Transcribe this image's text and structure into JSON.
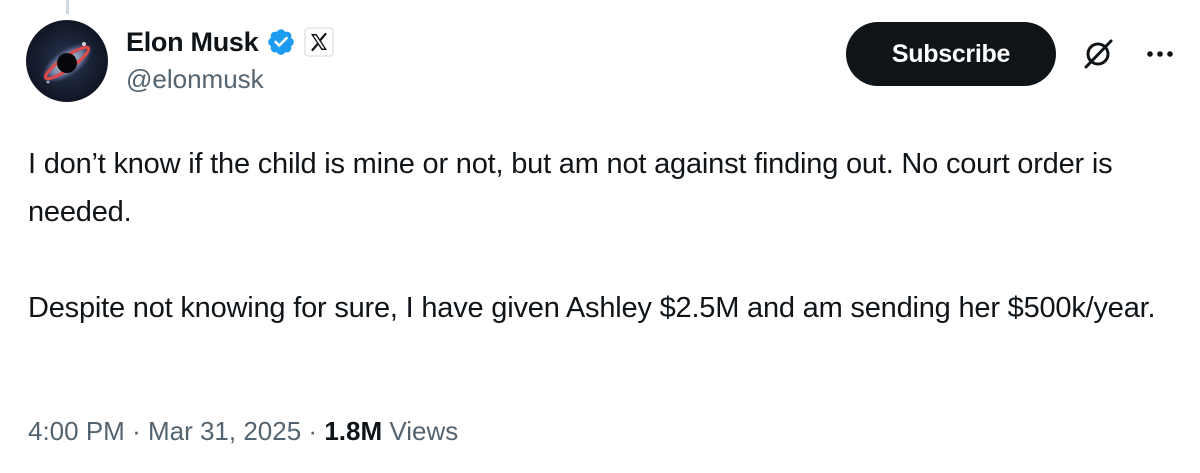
{
  "author": {
    "display_name": "Elon Musk",
    "handle": "@elonmusk",
    "verified_badge": "verified-badge-icon",
    "affiliation_badge": "x-logo-icon"
  },
  "actions": {
    "subscribe_label": "Subscribe",
    "grok_icon": "grok-icon",
    "more_icon": "more-icon"
  },
  "tweet": {
    "paragraphs": [
      "I don’t know if the child is mine or not, but am not against finding out. No court order is needed.",
      "Despite not knowing for sure, I have given Ashley $2.5M and am sending her $500k/year."
    ]
  },
  "meta": {
    "time": "4:00 PM",
    "separator": "·",
    "date": "Mar 31, 2025",
    "views_count": "1.8M",
    "views_label": "Views"
  },
  "colors": {
    "text_primary": "#0f1419",
    "text_secondary": "#536471",
    "verified_blue": "#1d9bf0",
    "button_bg": "#0f1419"
  }
}
